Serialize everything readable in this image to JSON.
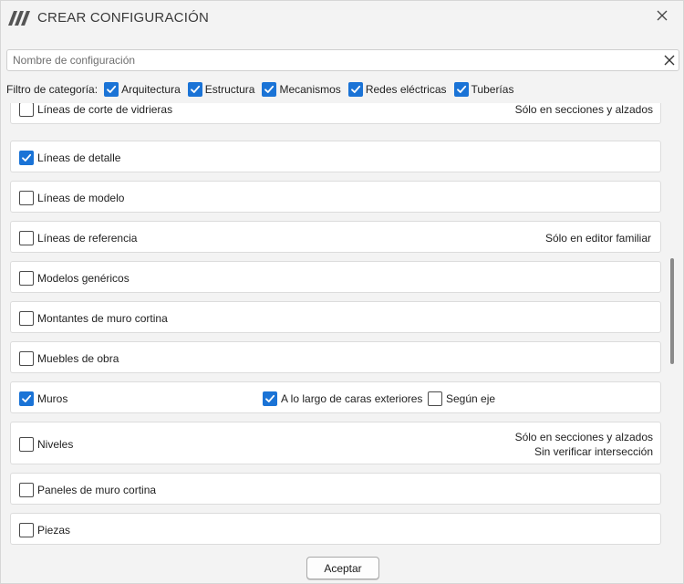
{
  "window": {
    "title": "CREAR CONFIGURACIÓN",
    "logo_icon": "app-logo-icon",
    "close_icon": "close-icon"
  },
  "search": {
    "placeholder": "Nombre de configuración",
    "value": "",
    "clear_icon": "close-icon"
  },
  "filter": {
    "label": "Filtro de categoría:",
    "items": [
      {
        "label": "Arquitectura",
        "checked": true
      },
      {
        "label": "Estructura",
        "checked": true
      },
      {
        "label": "Mecanismos",
        "checked": true
      },
      {
        "label": "Redes eléctricas",
        "checked": true
      },
      {
        "label": "Tuberías",
        "checked": true
      }
    ]
  },
  "rows": [
    {
      "label": "Líneas de corte de vidrieras",
      "checked": false,
      "notes": [
        "Sólo en secciones y alzados"
      ]
    },
    {
      "label": "Líneas de detalle",
      "checked": true,
      "notes": []
    },
    {
      "label": "Líneas de modelo",
      "checked": false,
      "notes": []
    },
    {
      "label": "Líneas de referencia",
      "checked": false,
      "notes": [
        "Sólo en editor familiar"
      ]
    },
    {
      "label": "Modelos genéricos",
      "checked": false,
      "notes": []
    },
    {
      "label": "Montantes de muro cortina",
      "checked": false,
      "notes": []
    },
    {
      "label": "Muebles de obra",
      "checked": false,
      "notes": []
    },
    {
      "label": "Muros",
      "checked": true,
      "notes": [],
      "options": [
        {
          "label": "A lo largo de caras exteriores",
          "checked": true
        },
        {
          "label": "Según eje",
          "checked": false
        }
      ]
    },
    {
      "label": "Niveles",
      "checked": false,
      "notes": [
        "Sólo en secciones y alzados",
        "Sin verificar intersección"
      ]
    },
    {
      "label": "Paneles de muro cortina",
      "checked": false,
      "notes": []
    },
    {
      "label": "Piezas",
      "checked": false,
      "notes": []
    }
  ],
  "footer": {
    "accept_label": "Aceptar"
  },
  "colors": {
    "accent": "#1a73d6",
    "background": "#f3f3f3",
    "row_background": "#ffffff"
  }
}
